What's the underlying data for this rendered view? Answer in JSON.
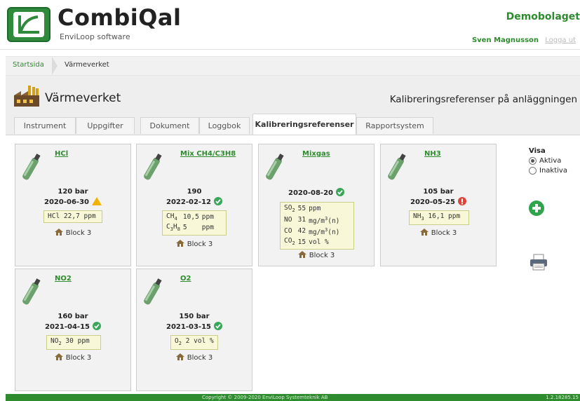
{
  "app": {
    "name": "CombiQal",
    "tagline": "EnviLoop software",
    "company": "Demobolaget",
    "user": "Sven Magnusson",
    "logout": "Logga ut",
    "brand_color": "#2e8b2e"
  },
  "breadcrumb": {
    "home": "Startsida",
    "current": "Värmeverket"
  },
  "page": {
    "site_title": "Värmeverket",
    "section_title": "Kalibreringsreferenser på anläggningen"
  },
  "tabs": [
    {
      "label": "Instrument",
      "active": false
    },
    {
      "label": "Uppgifter",
      "active": false
    },
    {
      "label": "Dokument",
      "active": false
    },
    {
      "label": "Loggbok",
      "active": false
    },
    {
      "label": "Kalibreringsreferenser",
      "active": true
    },
    {
      "label": "Rapportsystem",
      "active": false
    }
  ],
  "cards": [
    {
      "name": "HCl",
      "pressure": "120 bar",
      "date": "2020-06-30",
      "status": "warning",
      "components": [
        {
          "formula": "HCl",
          "value": "22,7",
          "unit": "ppm"
        }
      ],
      "location": "Block 3"
    },
    {
      "name": "Mix CH4/C3H8",
      "pressure": "190",
      "date": "2022-02-12",
      "status": "ok",
      "components": [
        {
          "formula": "CH4",
          "value": "10,5",
          "unit": "ppm"
        },
        {
          "formula": "C3H8",
          "value": "5",
          "unit": "ppm"
        }
      ],
      "location": "Block 3"
    },
    {
      "name": "Mixgas",
      "pressure": "",
      "date": "2020-08-20",
      "status": "ok",
      "components": [
        {
          "formula": "SO2",
          "value": "55",
          "unit": "ppm"
        },
        {
          "formula": "NO",
          "value": "31",
          "unit": "mg/m3(n)"
        },
        {
          "formula": "CO",
          "value": "42",
          "unit": "mg/m3(n)"
        },
        {
          "formula": "CO2",
          "value": "15",
          "unit": "vol %"
        }
      ],
      "location": "Block 3"
    },
    {
      "name": "NH3",
      "pressure": "105 bar",
      "date": "2020-05-25",
      "status": "error",
      "components": [
        {
          "formula": "NH3",
          "value": "16,1",
          "unit": "ppm"
        }
      ],
      "location": "Block 3"
    },
    {
      "name": "NO2",
      "pressure": "160 bar",
      "date": "2021-04-15",
      "status": "ok",
      "components": [
        {
          "formula": "NO2",
          "value": "30",
          "unit": "ppm"
        }
      ],
      "location": "Block 3"
    },
    {
      "name": "O2",
      "pressure": "150 bar",
      "date": "2021-03-15",
      "status": "ok",
      "components": [
        {
          "formula": "O2",
          "value": "2",
          "unit": "vol %"
        }
      ],
      "location": "Block 3"
    }
  ],
  "filter": {
    "label": "Visa",
    "options": [
      {
        "label": "Aktiva",
        "selected": true
      },
      {
        "label": "Inaktiva",
        "selected": false
      }
    ]
  },
  "footer": {
    "copyright": "Copyright © 2009-2020 EnviLoop Systemteknik AB",
    "version": "1.2.18285.15"
  }
}
